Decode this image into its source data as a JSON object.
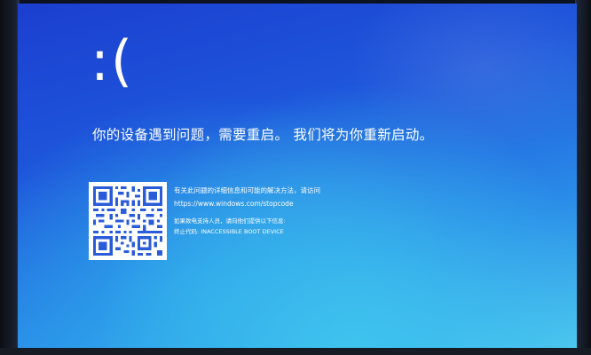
{
  "bsod": {
    "face": ":(",
    "headline": "你的设备遇到问题，需要重启。 我们将为你重新启动。",
    "qr_icon": "qr-code-icon",
    "info_line": "有关此问题的详细信息和可能的解决方法，请访问",
    "url": "https://www.windows.com/stopcode",
    "support_line": "如果致电支持人员，请向他们提供以下信息:",
    "stop_code": "终止代码: INACCESSIBLE BOOT DEVICE"
  },
  "colors": {
    "screen_top": "#1b3fd0",
    "screen_bottom": "#4cc7ee",
    "text": "#ffffff"
  }
}
